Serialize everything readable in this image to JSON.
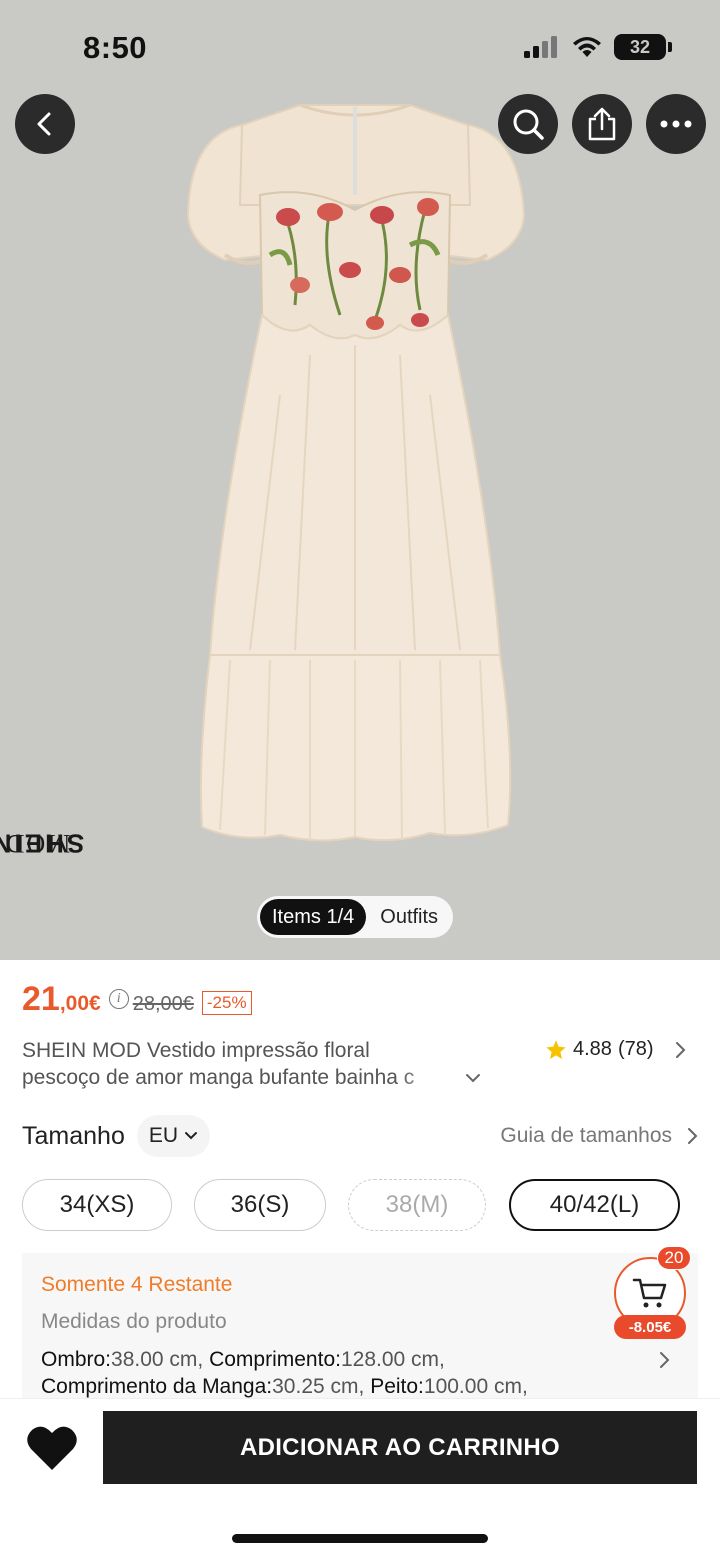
{
  "status_bar": {
    "time": "8:50",
    "battery": "32",
    "icons": [
      "signal-icon",
      "wifi-icon",
      "battery-icon"
    ]
  },
  "hero": {
    "brand_sheine": "SHEIN",
    "brand_mod": "MOD",
    "toggle": {
      "items_label": "Items 1/4",
      "outfits_label": "Outfits"
    },
    "buttons": [
      "back-icon",
      "search-icon",
      "share-icon",
      "more-icon"
    ]
  },
  "product": {
    "price_integer": "21",
    "price_decimal": ",00€",
    "price_original": "28,00€",
    "discount": "-25%",
    "title_line1": "SHEIN MOD Vestido impressão floral",
    "title_line2": "pescoço de amor manga bufante bainha c",
    "rating_value": "4.88",
    "rating_count": "(78)"
  },
  "size": {
    "label": "Tamanho",
    "region": "EU",
    "guide_label": "Guia de tamanhos",
    "options": [
      {
        "label": "34(XS)",
        "state": "available"
      },
      {
        "label": "36(S)",
        "state": "available"
      },
      {
        "label": "38(M)",
        "state": "unavailable"
      },
      {
        "label": "40/42(L)",
        "state": "selected"
      }
    ]
  },
  "stock": {
    "remaining": "Somente 4 Restante",
    "measures_title": "Medidas do produto",
    "shoulder_label": "Ombro:",
    "shoulder_value": "38.00 cm,",
    "length_label": "Comprimento:",
    "length_value": "128.00 cm,",
    "sleeve_label": "Comprimento da Manga:",
    "sleeve_value": "30.25 cm,",
    "chest_label": "Peito:",
    "chest_value": "100.00 cm,"
  },
  "cart": {
    "count": "20",
    "saving": "-8.05€"
  },
  "actions": {
    "add_to_cart": "ADICIONAR AO CARRINHO"
  },
  "colors": {
    "accent": "#e85a2b",
    "stock": "#f07c2a",
    "hero_bg": "#c9cac6",
    "button_dark": "#1f1f1f"
  }
}
